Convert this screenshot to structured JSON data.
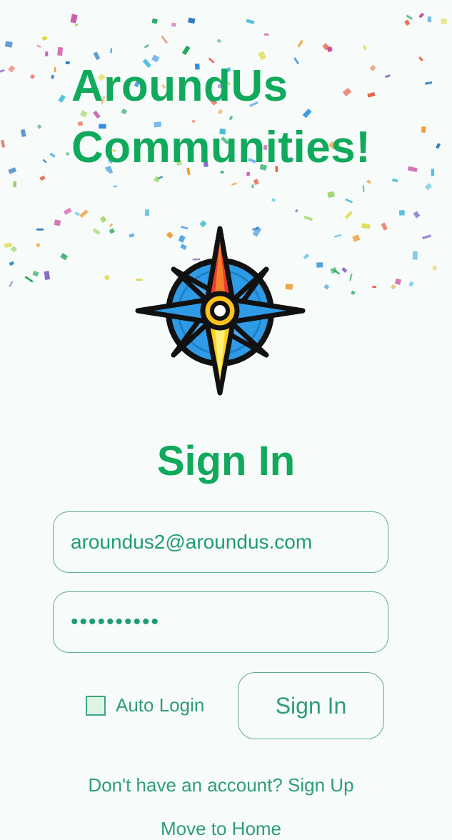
{
  "app": {
    "title_line1": "AroundUs",
    "title_line2": "Communities!"
  },
  "logo": {
    "icon": "compass-icon"
  },
  "form": {
    "heading": "Sign In",
    "email_value": "aroundus2@aroundus.com",
    "password_value": "••••••••••",
    "auto_login_label": "Auto Login",
    "auto_login_checked": false,
    "signin_button": "Sign In",
    "signup_link": "Don't have an account? Sign Up",
    "home_link": "Move to Home"
  },
  "colors": {
    "brand_green": "#11a95c",
    "text_teal": "#2e9d78",
    "border": "#5fa89b",
    "background": "#f7fbfa"
  }
}
